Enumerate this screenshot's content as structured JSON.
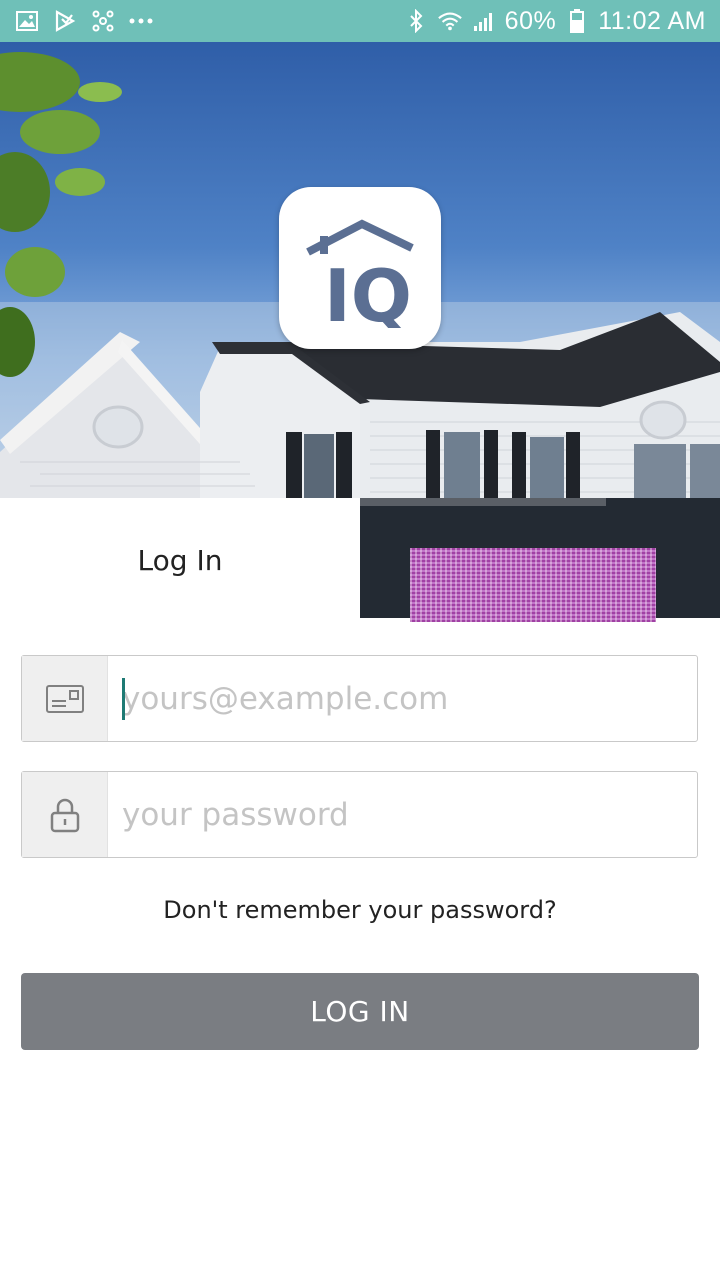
{
  "status_bar": {
    "left_icons": [
      "gallery-icon",
      "play-store-icon",
      "network-icon",
      "more-dots-icon"
    ],
    "right_icons": [
      "bluetooth-icon",
      "wifi-icon",
      "signal-icon",
      "battery-icon"
    ],
    "battery": "60%",
    "time": "11:02 AM"
  },
  "hero": {
    "logo_icon": "house-iq-logo",
    "logo_text": "IQ"
  },
  "tabs": {
    "login_label": "Log In"
  },
  "form": {
    "email": {
      "placeholder": "yours@example.com",
      "value": "",
      "icon": "envelope-icon"
    },
    "password": {
      "placeholder": "your password",
      "value": "",
      "icon": "lock-icon"
    },
    "forgot_label": "Don't remember your password?",
    "submit_label": "LOG IN"
  },
  "colors": {
    "status_bar": "#6fc0b8",
    "button": "#7a7d82",
    "logo": "#5b6f93"
  }
}
